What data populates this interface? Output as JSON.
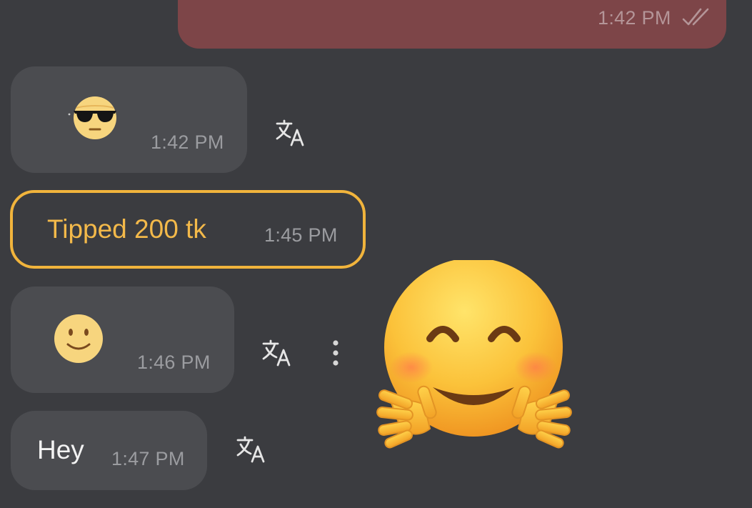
{
  "messages": {
    "outgoing_top": {
      "time": "1:42 PM",
      "status_icon": "double-check-icon"
    },
    "incoming_sunglasses": {
      "emoji_icon": "sunglasses-emoji-icon",
      "time": "1:42 PM"
    },
    "tip": {
      "text": "Tipped 200 tk",
      "time": "1:45 PM",
      "accent": "#f1b43c"
    },
    "incoming_smile": {
      "emoji_icon": "slightly-smiling-emoji-icon",
      "time": "1:46 PM"
    },
    "incoming_hey": {
      "text": "Hey",
      "time": "1:47 PM"
    }
  },
  "icons": {
    "translate": "translate-icon",
    "more": "more-vertical-icon",
    "reaction": "hugging-face-emoji-icon"
  },
  "colors": {
    "background": "#3b3c40",
    "incoming_bubble": "#4b4c50",
    "outgoing_bubble": "#7d4548",
    "tip_accent": "#f1b43c",
    "timestamp": "#9b9ca0"
  }
}
